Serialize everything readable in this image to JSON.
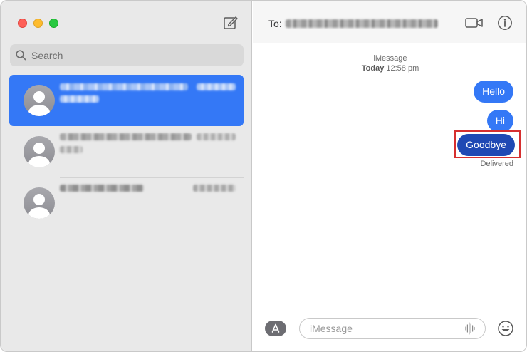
{
  "sidebar": {
    "search": {
      "placeholder": "Search"
    },
    "conversations": [
      {
        "selected": true
      },
      {
        "selected": false
      },
      {
        "selected": false
      }
    ]
  },
  "chat": {
    "to_label": "To:",
    "service_label": "iMessage",
    "timestamp_day": "Today",
    "timestamp_time": "12:58 pm",
    "messages": [
      {
        "text": "Hello",
        "from": "me"
      },
      {
        "text": "Hi",
        "from": "me"
      },
      {
        "text": "Goodbye",
        "from": "me",
        "highlighted": true
      }
    ],
    "delivery_status": "Delivered",
    "input_placeholder": "iMessage"
  },
  "colors": {
    "accent": "#3478f6",
    "selected_bubble": "#1f49b4",
    "highlight_border": "#d62f2f"
  }
}
